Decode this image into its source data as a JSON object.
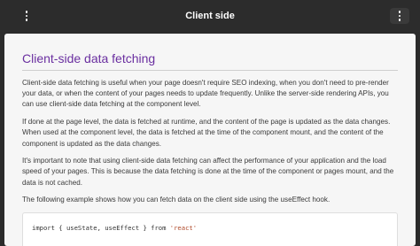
{
  "header": {
    "title": "Client side",
    "left_menu_icon": "vertical-dots-icon",
    "right_menu_icon": "vertical-dots-icon"
  },
  "article": {
    "heading": "Client-side data fetching",
    "paragraphs": [
      "Client-side data fetching is useful when your page doesn't require SEO indexing, when you don't need to pre-render your data, or when the content of your pages needs to update frequently. Unlike the server-side rendering APIs, you can use client-side data fetching at the component level.",
      "If done at the page level, the data is fetched at runtime, and the content of the page is updated as the data changes. When used at the component level, the data is fetched at the time of the component mount, and the content of the component is updated as the data changes.",
      "It's important to note that using client-side data fetching can affect the performance of your application and the load speed of your pages. This is because the data fetching is done at the time of the component or pages mount, and the data is not cached.",
      "The following example shows how you can fetch data on the client side using the useEffect hook."
    ],
    "code": {
      "line1_prefix": "import { useState, useEffect } from ",
      "line1_string": "'react'"
    }
  },
  "colors": {
    "heading": "#6a2fa0",
    "topbar": "#2c2c2c",
    "card": "#f6f6f6"
  }
}
